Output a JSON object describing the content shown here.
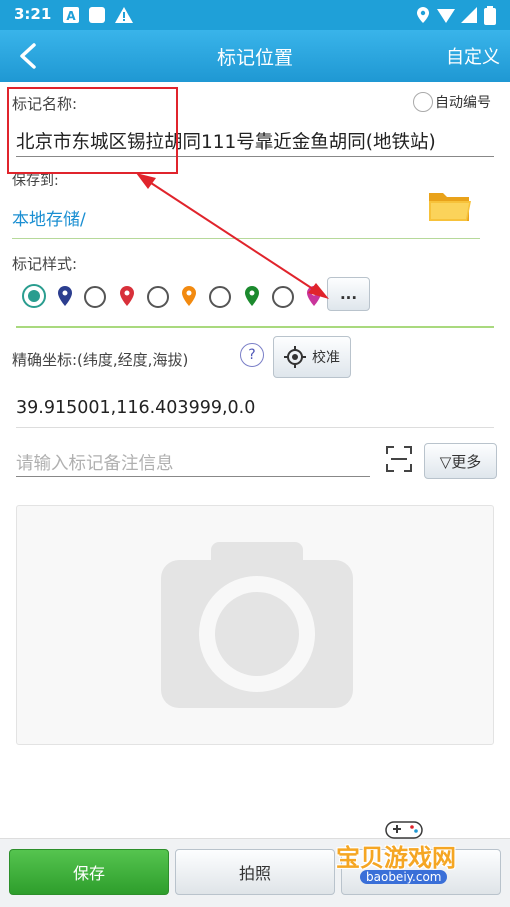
{
  "status_bar": {
    "time": "3:21",
    "left_icons": [
      "a-box-icon",
      "square-icon",
      "warning-icon"
    ],
    "right_icons": [
      "location-icon",
      "wifi-icon",
      "signal-icon",
      "battery-icon"
    ]
  },
  "header": {
    "title": "标记位置",
    "right_action": "自定义"
  },
  "form": {
    "name_label": "标记名称:",
    "auto_number_label": "自动编号",
    "name_value": "北京市东城区锡拉胡同111号靠近金鱼胡同(地铁站)",
    "save_to_label": "保存到:",
    "save_to_value": "本地存储/",
    "style_label": "标记样式:",
    "style_more_button": "...",
    "coord_label": "精确坐标:(纬度,经度,海拔)",
    "help_icon": "?",
    "calibrate_button": "校准",
    "coord_value": "39.915001,116.403999,0.0",
    "note_placeholder": "请输入标记备注信息",
    "more_button": "▽更多"
  },
  "pin_colors": [
    "#2c3e8f",
    "#d8303a",
    "#f28a10",
    "#1c8a2e",
    "#c9349b"
  ],
  "bottom_bar": {
    "save_button": "保存",
    "photo_button": "拍照",
    "third_button": "宝贝游戏网"
  },
  "watermark": {
    "title": "宝贝游戏网",
    "url": "baobeiy.com"
  },
  "colors": {
    "accent": "#1f98d3",
    "annotation": "#e0242c",
    "save_green": "#3cae3a"
  }
}
